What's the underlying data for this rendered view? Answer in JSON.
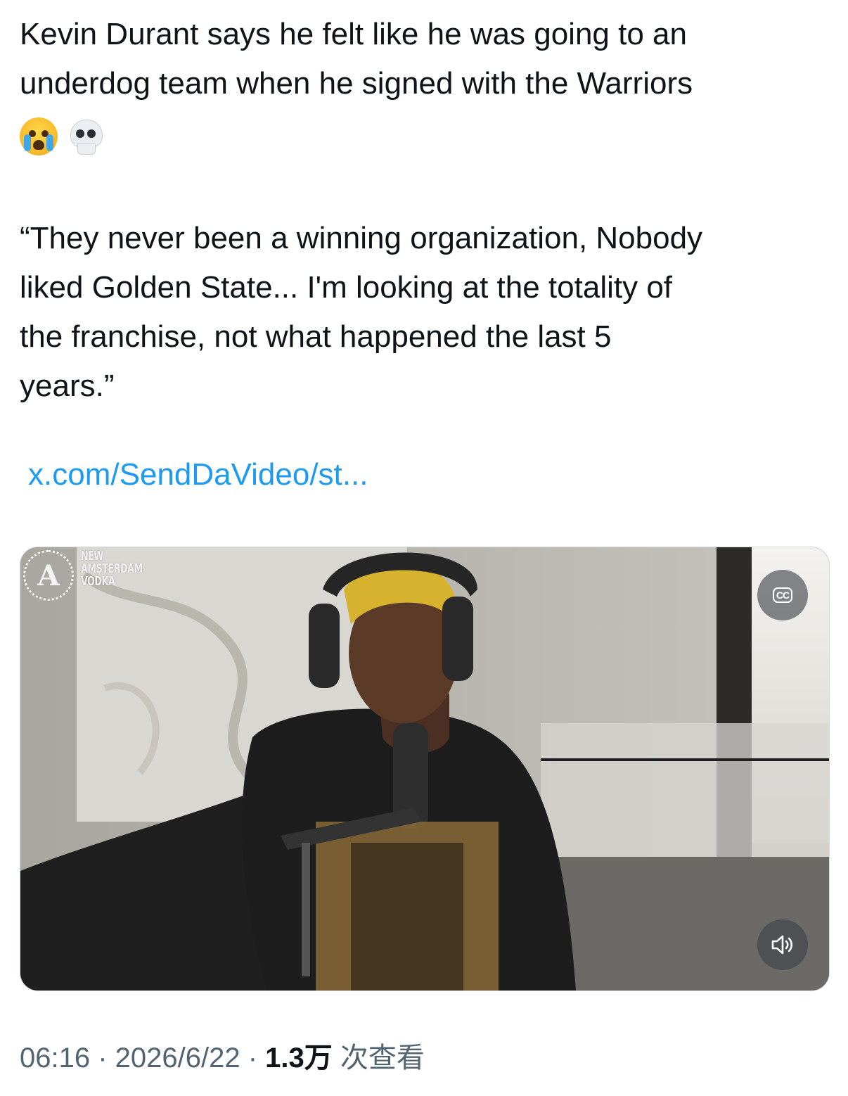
{
  "tweet": {
    "line1": "Kevin Durant says he felt like he was going to an",
    "line2": "underdog team when he signed with the Warriors",
    "emojis": [
      "loudly-crying-face-icon",
      "skull-icon"
    ],
    "quote_lines": [
      "“They never been a winning organization, Nobody",
      "liked Golden State... I'm looking at the totality of",
      "the franchise, not what happened the last 5",
      "years.”"
    ],
    "link": "x.com/SendDaVideo/st..."
  },
  "media": {
    "type": "video",
    "watermark_text": "NEW\nAMSTERDAM\nVODKA",
    "cc_label": "CC",
    "controls": [
      "closed-captions-icon",
      "volume-icon"
    ]
  },
  "meta": {
    "time": "06:16",
    "separator": " · ",
    "date": "2026/6/22",
    "views_count": "1.3万",
    "views_label": " 次查看"
  },
  "colors": {
    "text": "#0f1419",
    "link": "#1d9bf0",
    "secondary": "#536471"
  }
}
